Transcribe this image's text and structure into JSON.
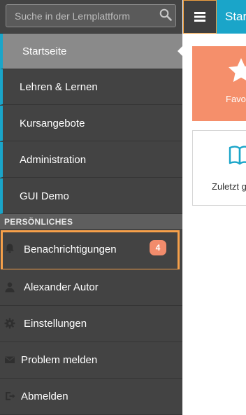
{
  "search": {
    "placeholder": "Suche in der Lernplattform"
  },
  "nav": {
    "items": [
      {
        "label": "Startseite"
      },
      {
        "label": "Lehren & Lernen"
      },
      {
        "label": "Kursangebote"
      },
      {
        "label": "Administration"
      },
      {
        "label": "GUI Demo"
      }
    ]
  },
  "personal": {
    "header": "PERSÖNLICHES",
    "items": [
      {
        "label": "Benachrichtigungen",
        "icon": "bell-icon",
        "badge": "4"
      },
      {
        "label": "Alexander Autor",
        "icon": "user-icon"
      },
      {
        "label": "Einstellungen",
        "icon": "gear-icon"
      },
      {
        "label": "Problem melden",
        "icon": "envelope-icon"
      },
      {
        "label": "Abmelden",
        "icon": "logout-icon"
      }
    ]
  },
  "topbar": {
    "title": "Star"
  },
  "tiles": {
    "favorites_label": "Favo",
    "recent_label": "Zuletzt g"
  },
  "colors": {
    "sidebar_bg": "#434343",
    "accent": "#1aa5c9",
    "highlight": "#f6a04a",
    "badge": "#f28c6c",
    "favorites_tile": "#f58f6b"
  }
}
